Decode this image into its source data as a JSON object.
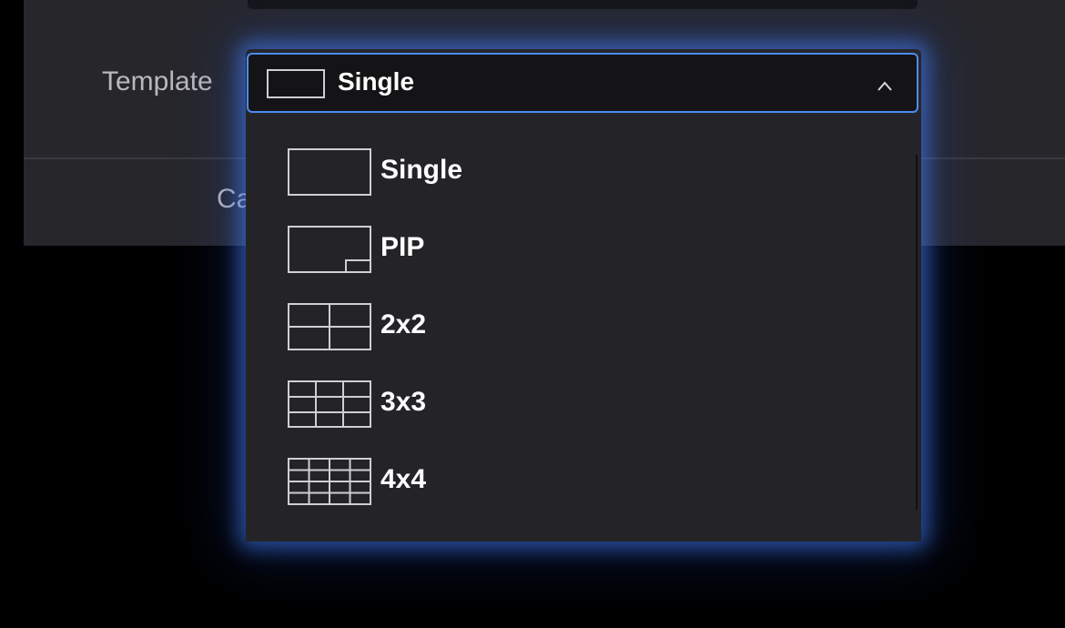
{
  "dialog": {
    "template_label": "Template",
    "cancel_label": "Ca"
  },
  "select": {
    "value": "Single",
    "open": true,
    "focus_color": "#4b8df8"
  },
  "options": [
    {
      "label": "Single",
      "icon": "single-layout-icon"
    },
    {
      "label": "PIP",
      "icon": "pip-layout-icon"
    },
    {
      "label": "2x2",
      "icon": "grid-2x2-icon"
    },
    {
      "label": "3x3",
      "icon": "grid-3x3-icon"
    },
    {
      "label": "4x4",
      "icon": "grid-4x4-icon"
    }
  ],
  "colors": {
    "dialog_bg": "#26262b",
    "menu_bg": "#242428",
    "text_primary": "#ffffff",
    "text_secondary": "#b9b9bd"
  }
}
